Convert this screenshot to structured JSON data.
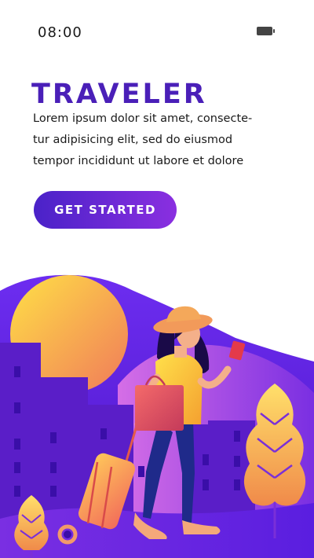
{
  "status_bar": {
    "time": "08:00",
    "battery_icon": "battery-icon"
  },
  "hero": {
    "title": "TRAVELER",
    "description": "Lorem ipsum dolor sit amet, consecte-tur adipisicing elit, sed do eiusmod tempor incididunt ut labore et dolore",
    "cta_label": "GET STARTED"
  },
  "illustration": {
    "subject": "traveler-woman-with-suitcase-illustration"
  },
  "colors": {
    "title": "#4a1fb8",
    "button_start": "#4a22c8",
    "button_end": "#8a2fe0",
    "sun": "#f7c84a"
  }
}
